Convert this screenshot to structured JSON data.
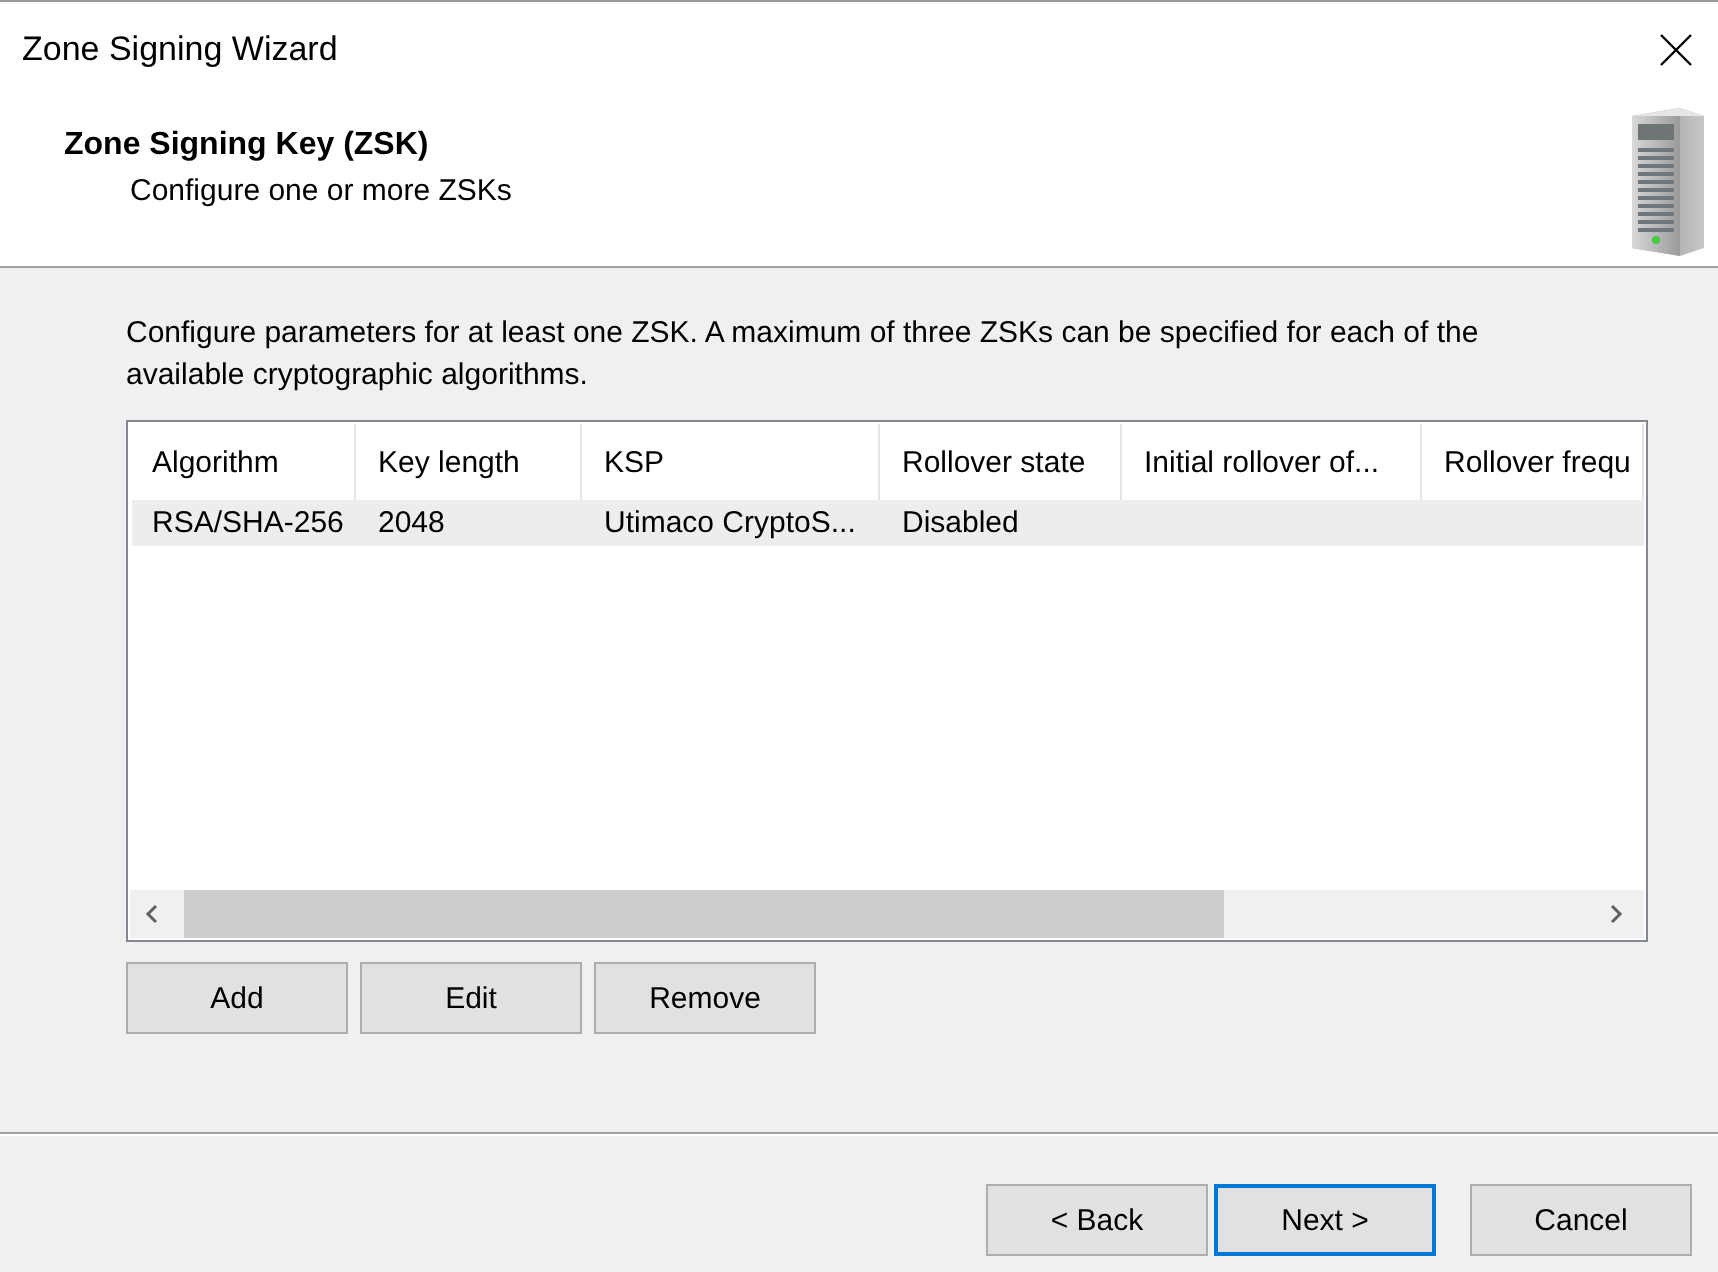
{
  "window": {
    "title": "Zone Signing Wizard"
  },
  "header": {
    "title": "Zone Signing Key (ZSK)",
    "subtitle": "Configure one or more ZSKs"
  },
  "description": "Configure parameters for at least one ZSK. A maximum of three ZSKs can be specified for each of the available cryptographic algorithms.",
  "table": {
    "columns": [
      "Algorithm",
      "Key length",
      "KSP",
      "Rollover state",
      "Initial rollover of...",
      "Rollover frequ"
    ],
    "rows": [
      {
        "cells": [
          "RSA/SHA-256",
          "2048",
          "Utimaco CryptoS...",
          "Disabled"
        ],
        "selected": true
      }
    ]
  },
  "list_buttons": [
    "Add",
    "Edit",
    "Remove"
  ],
  "nav_buttons": [
    {
      "label": "< Back",
      "default": false
    },
    {
      "label": "Next >",
      "default": true
    },
    {
      "label": "Cancel",
      "default": false
    }
  ]
}
